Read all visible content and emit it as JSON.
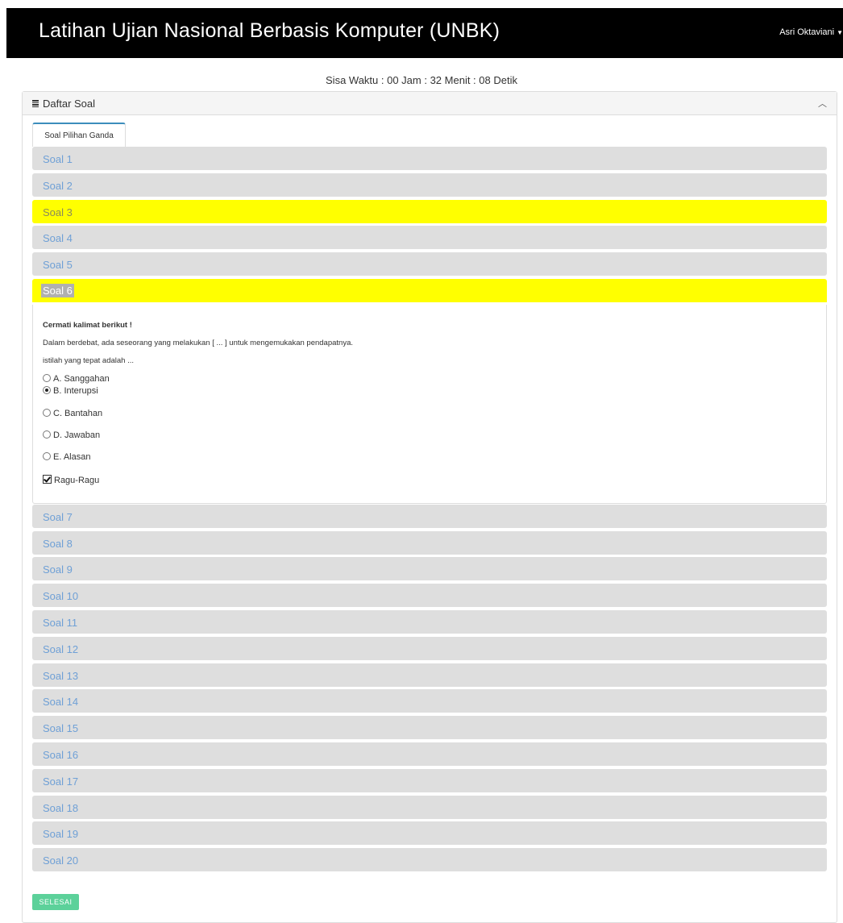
{
  "header": {
    "title": "Latihan Ujian Nasional Berbasis Komputer (UNBK)",
    "user": "Asri Oktaviani"
  },
  "timer": "Sisa Waktu : 00 Jam : 32 Menit : 08 Detik",
  "panel": {
    "title": "Daftar Soal",
    "tab": "Soal Pilihan Ganda"
  },
  "soal": [
    {
      "label": "Soal 1",
      "state": "default"
    },
    {
      "label": "Soal 2",
      "state": "default"
    },
    {
      "label": "Soal 3",
      "state": "marked"
    },
    {
      "label": "Soal 4",
      "state": "default"
    },
    {
      "label": "Soal 5",
      "state": "default"
    },
    {
      "label": "Soal 6",
      "state": "open"
    },
    {
      "label": "Soal 7",
      "state": "default"
    },
    {
      "label": "Soal 8",
      "state": "default"
    },
    {
      "label": "Soal 9",
      "state": "default"
    },
    {
      "label": "Soal 10",
      "state": "default"
    },
    {
      "label": "Soal 11",
      "state": "default"
    },
    {
      "label": "Soal 12",
      "state": "default"
    },
    {
      "label": "Soal 13",
      "state": "default"
    },
    {
      "label": "Soal 14",
      "state": "default"
    },
    {
      "label": "Soal 15",
      "state": "default"
    },
    {
      "label": "Soal 16",
      "state": "default"
    },
    {
      "label": "Soal 17",
      "state": "default"
    },
    {
      "label": "Soal 18",
      "state": "default"
    },
    {
      "label": "Soal 19",
      "state": "default"
    },
    {
      "label": "Soal 20",
      "state": "default"
    }
  ],
  "question": {
    "heading": "Cermati kalimat berikut !",
    "text": "Dalam berdebat, ada seseorang yang melakukan [ ... ] untuk mengemukakan pendapatnya.",
    "prompt": "istilah yang tepat adalah ...",
    "options": [
      {
        "label": "A. Sanggahan",
        "checked": false
      },
      {
        "label": "B. Interupsi",
        "checked": true
      },
      {
        "label": "C. Bantahan",
        "checked": false
      },
      {
        "label": "D. Jawaban",
        "checked": false
      },
      {
        "label": "E. Alasan",
        "checked": false
      }
    ],
    "ragu": {
      "label": "Ragu-Ragu",
      "checked": true
    }
  },
  "colors": {
    "marked": "#ffff00",
    "item_bg": "#dedede",
    "item_text": "#6fa0d6",
    "finish_button": "#5cd19a"
  },
  "finish_button": "SELESAI"
}
